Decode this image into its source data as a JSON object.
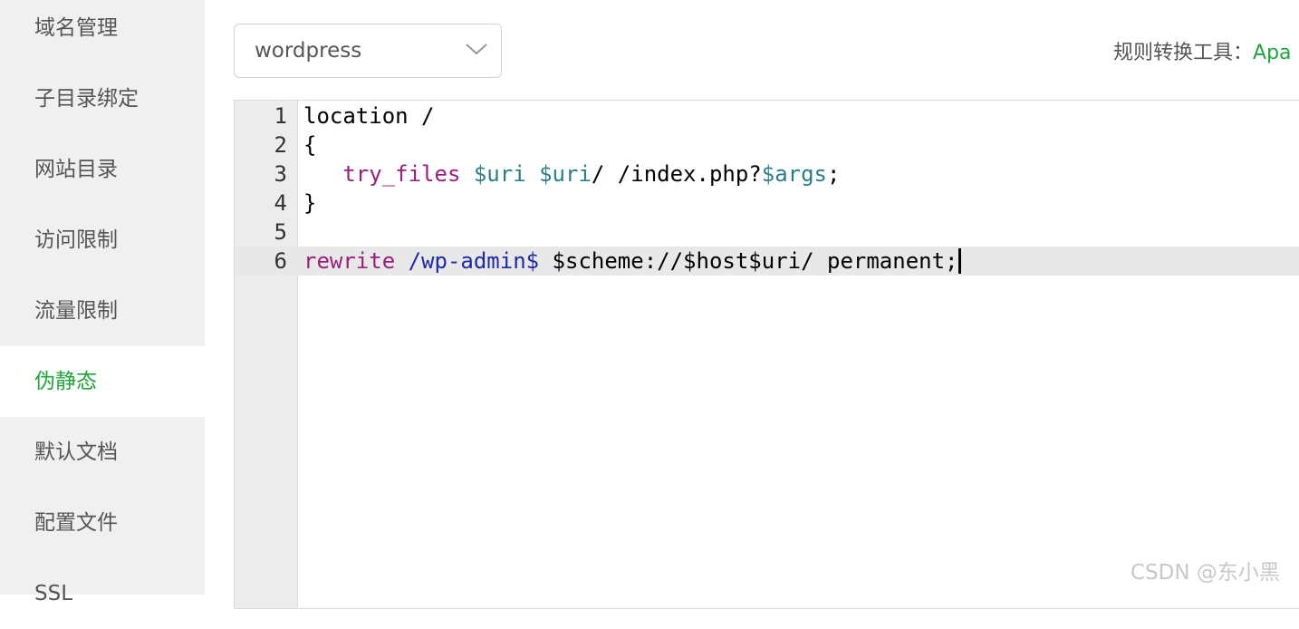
{
  "sidebar": {
    "items": [
      {
        "label": "域名管理",
        "active": false
      },
      {
        "label": "子目录绑定",
        "active": false
      },
      {
        "label": "网站目录",
        "active": false
      },
      {
        "label": "访问限制",
        "active": false
      },
      {
        "label": "流量限制",
        "active": false
      },
      {
        "label": "伪静态",
        "active": true
      },
      {
        "label": "默认文档",
        "active": false
      },
      {
        "label": "配置文件",
        "active": false
      },
      {
        "label": "SSL",
        "active": false
      }
    ]
  },
  "template_select": {
    "value": "wordpress",
    "icon": "chevron-down-icon"
  },
  "converter": {
    "label": "规则转换工具：",
    "link": "Apa"
  },
  "editor": {
    "lines": [
      {
        "num": "1",
        "tokens": [
          {
            "t": "location /",
            "c": "plain"
          }
        ]
      },
      {
        "num": "2",
        "tokens": [
          {
            "t": "{",
            "c": "plain"
          }
        ]
      },
      {
        "num": "3",
        "tokens": [
          {
            "t": "   ",
            "c": "plain"
          },
          {
            "t": "try_files",
            "c": "kw"
          },
          {
            "t": " ",
            "c": "plain"
          },
          {
            "t": "$uri",
            "c": "var"
          },
          {
            "t": " ",
            "c": "plain"
          },
          {
            "t": "$uri",
            "c": "var"
          },
          {
            "t": "/ /index.php?",
            "c": "plain"
          },
          {
            "t": "$args",
            "c": "var"
          },
          {
            "t": ";",
            "c": "plain"
          }
        ]
      },
      {
        "num": "4",
        "tokens": [
          {
            "t": "}",
            "c": "plain"
          }
        ]
      },
      {
        "num": "5",
        "tokens": []
      },
      {
        "num": "6",
        "active": true,
        "cursor": true,
        "tokens": [
          {
            "t": "rewrite",
            "c": "kw"
          },
          {
            "t": " ",
            "c": "plain"
          },
          {
            "t": "/wp-admin$",
            "c": "rx"
          },
          {
            "t": " $scheme://$host$uri/ permanent;",
            "c": "plain"
          }
        ]
      }
    ]
  },
  "watermark": "CSDN @东小黑",
  "colors": {
    "accent": "#20a53a",
    "keyword": "#9a1f7a",
    "variable": "#2a7f86",
    "regex": "#1d2aa8"
  }
}
